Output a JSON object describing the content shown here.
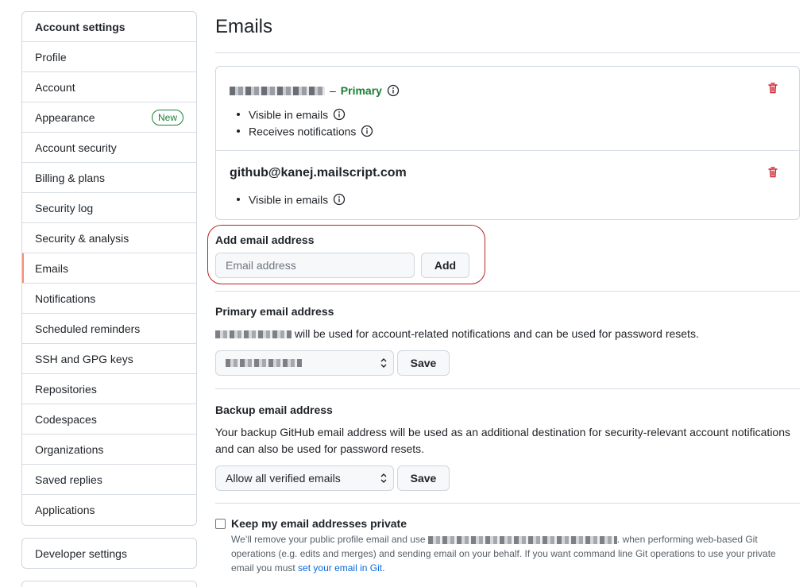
{
  "sidebar": {
    "header": "Account settings",
    "items": [
      {
        "label": "Profile"
      },
      {
        "label": "Account"
      },
      {
        "label": "Appearance",
        "badge": "New"
      },
      {
        "label": "Account security"
      },
      {
        "label": "Billing & plans"
      },
      {
        "label": "Security log"
      },
      {
        "label": "Security & analysis"
      },
      {
        "label": "Emails",
        "selected": true
      },
      {
        "label": "Notifications"
      },
      {
        "label": "Scheduled reminders"
      },
      {
        "label": "SSH and GPG keys"
      },
      {
        "label": "Repositories"
      },
      {
        "label": "Codespaces"
      },
      {
        "label": "Organizations"
      },
      {
        "label": "Saved replies"
      },
      {
        "label": "Applications"
      }
    ],
    "developer_settings": "Developer settings"
  },
  "main": {
    "title": "Emails",
    "emails": [
      {
        "dash": "–",
        "primary_label": "Primary",
        "bullets": [
          "Visible in emails",
          "Receives notifications"
        ]
      },
      {
        "address": "github@kanej.mailscript.com",
        "bullets": [
          "Visible in emails"
        ]
      }
    ],
    "add_email": {
      "label": "Add email address",
      "placeholder": "Email address",
      "button": "Add"
    },
    "primary_email": {
      "heading": "Primary email address",
      "description": "will be used for account-related notifications and can be used for password resets.",
      "save": "Save"
    },
    "backup_email": {
      "heading": "Backup email address",
      "description": "Your backup GitHub email address will be used as an additional destination for security-relevant account notifications and can also be used for password resets.",
      "select_value": "Allow all verified emails",
      "save": "Save"
    },
    "private": {
      "label": "Keep my email addresses private",
      "note_part1": "We’ll remove your public profile email and use",
      "note_part2": ". when performing web-based Git operations (e.g. edits and merges) and sending email on your behalf. If you want command line Git operations to use your private email you must",
      "link": "set your email in Git",
      "note_end": "."
    }
  },
  "colors": {
    "accent_selected": "#fd8c73",
    "primary_green": "#1a7f37",
    "danger_red": "#cf222e",
    "link_blue": "#0969da",
    "highlight_outline": "#b3261e"
  }
}
